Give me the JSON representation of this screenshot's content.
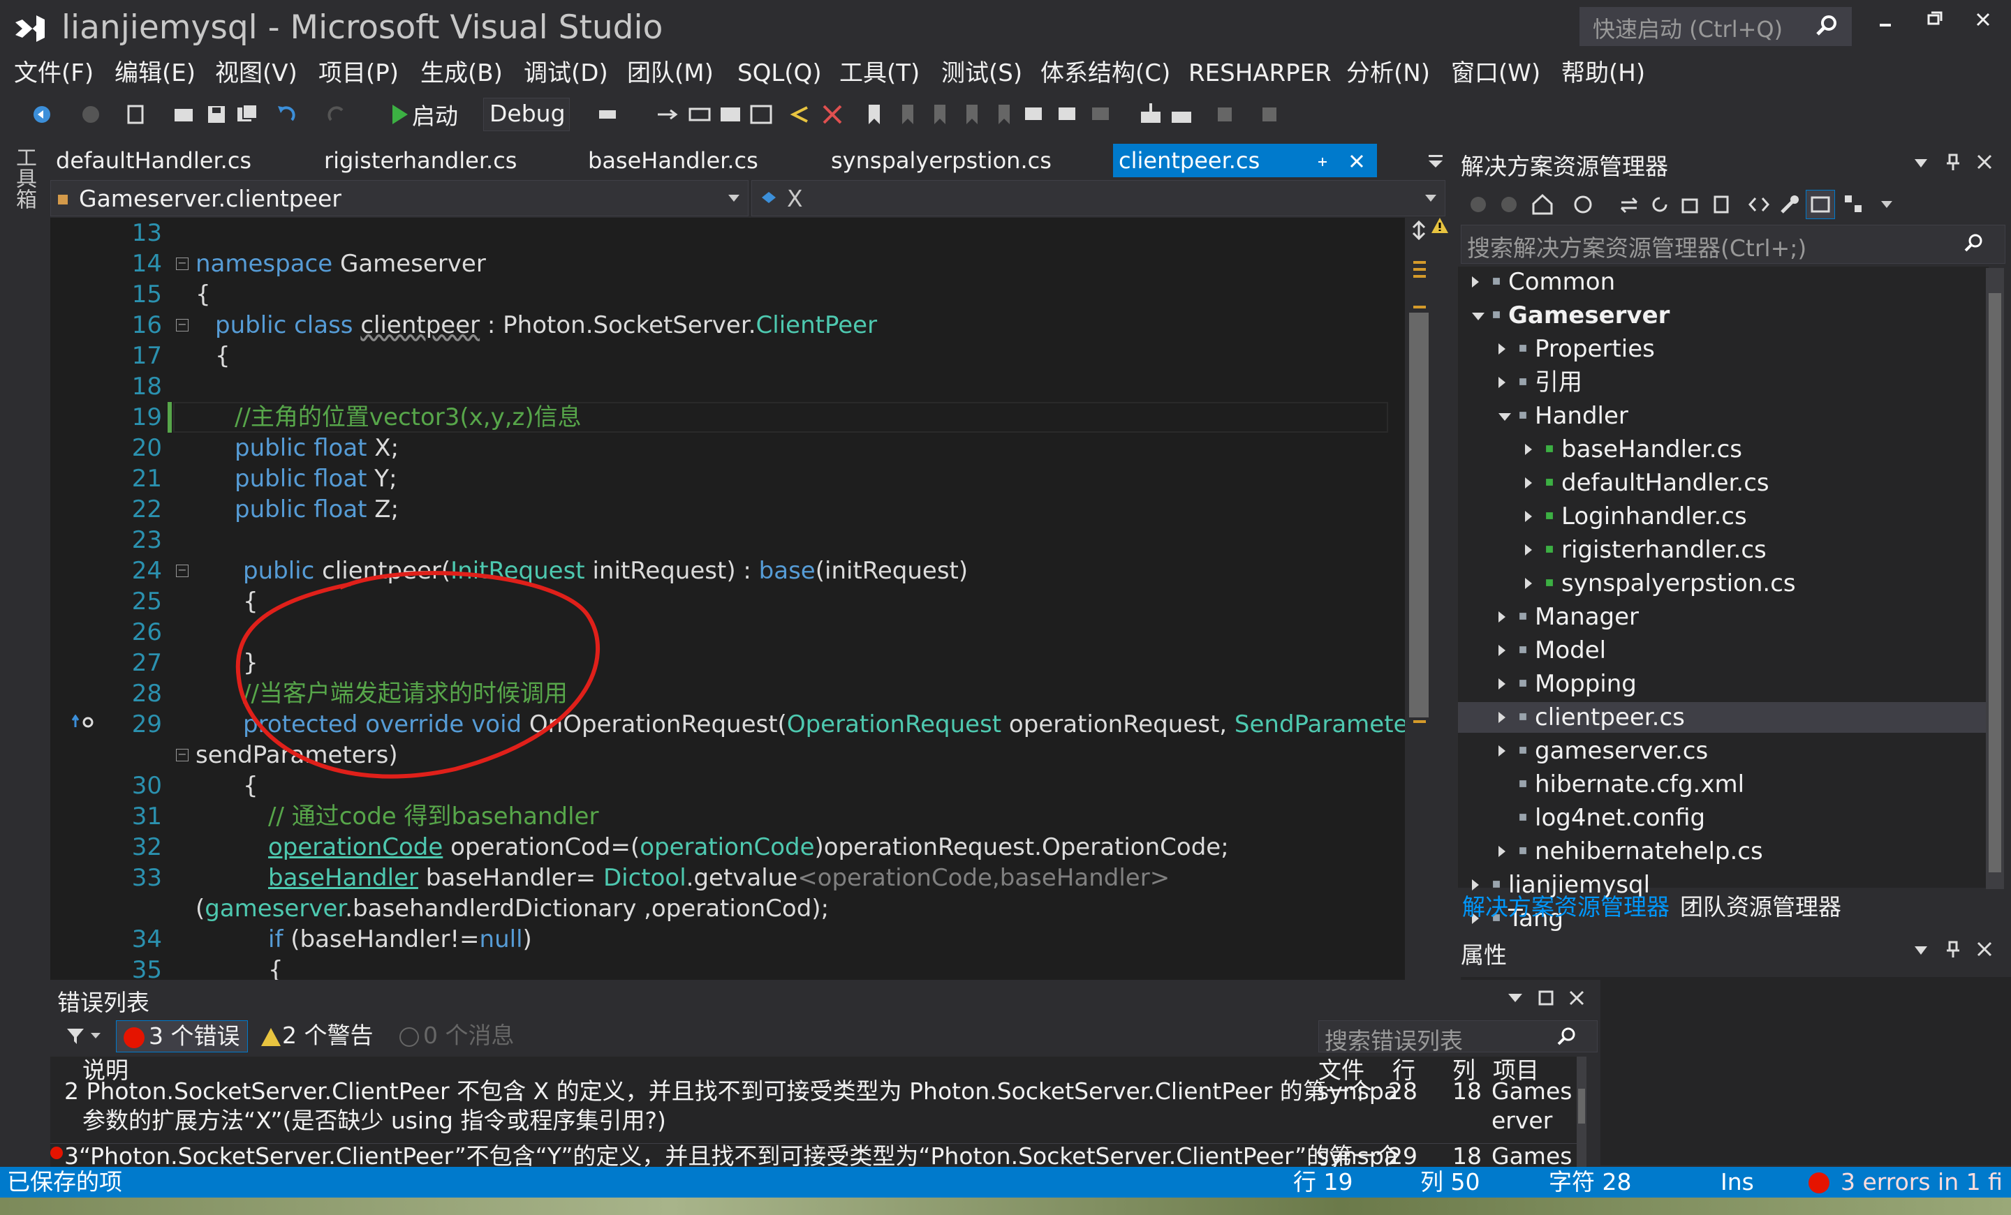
{
  "window": {
    "title": "lianjiemysql - Microsoft Visual Studio",
    "quick_launch_placeholder": "快速启动 (Ctrl+Q)"
  },
  "menu": [
    "文件(F)",
    "编辑(E)",
    "视图(V)",
    "项目(P)",
    "生成(B)",
    "调试(D)",
    "团队(M)",
    "SQL(Q)",
    "工具(T)",
    "测试(S)",
    "体系结构(C)",
    "RESHARPER",
    "分析(N)",
    "窗口(W)",
    "帮助(H)"
  ],
  "toolbar": {
    "start_label": "启动",
    "config_value": "Debug"
  },
  "toolbox_label": "工具箱",
  "tabs": [
    "defaultHandler.cs",
    "rigisterhandler.cs",
    "baseHandler.cs",
    "synspalyerpstion.cs",
    "clientpeer.cs"
  ],
  "nav": {
    "left": "Gameserver.clientpeer",
    "right": "X"
  },
  "code": {
    "line_numbers": [
      "13",
      "14",
      "15",
      "16",
      "17",
      "18",
      "19",
      "20",
      "21",
      "22",
      "23",
      "24",
      "25",
      "26",
      "27",
      "28",
      "29",
      "",
      "30",
      "31",
      "32",
      "33",
      "",
      "34",
      "35"
    ],
    "l14_kw": "namespace",
    "l14_name": " Gameserver",
    "brace_open": "{",
    "brace_close": "}",
    "l16_kw": "public class",
    "l16_name": "clientpeer",
    "l16_mid": " : Photon.SocketServer.",
    "l16_type": "ClientPeer",
    "l19_comment": "//主角的位置vector3(x,y,z)信息",
    "public_float": "public float",
    "x_field": " X;",
    "y_field": " Y;",
    "z_field": " Z;",
    "l24_kw": "public",
    "l24_name": " clientpeer(",
    "l24_type": "InitRequest",
    "l24_mid": " initRequest) : ",
    "l24_base": "base",
    "l24_end": "(initRequest)",
    "l28_comment": "//当客户端发起请求的时候调用",
    "l29_kw": "protected override void",
    "l29_name": " OnOperationRequest(",
    "l29_type1": "OperationRequest",
    "l29_mid": " operationRequest, ",
    "l29_type2": "SendParameters",
    "l29b": "sendParameters)",
    "l31_comment": "//  通过code 得到basehandler",
    "l32_type": "operationCode",
    "l32_a": " operationCod=(",
    "l32_type2": "operationCode",
    "l32_b": ")operationRequest.OperationCode;",
    "l33_type": "baseHandler",
    "l33_a": " baseHandler= ",
    "l33_type2": "Dictool",
    "l33_b": ".getvalue",
    "l33_gen": "<operationCode,baseHandler>",
    "l33b_a": "(",
    "l33b_type": "gameserver",
    "l33b_b": ".basehandlerdDictionary ,operationCod);",
    "l34_kw": "if",
    "l34_a": " (baseHandler!=",
    "l34_null": "null",
    "l34_b": ")"
  },
  "solution_explorer": {
    "title": "解决方案资源管理器",
    "search_placeholder": "搜索解决方案资源管理器(Ctrl+;)",
    "items": [
      {
        "label": "Common",
        "depth": 0,
        "arrow": "closed"
      },
      {
        "label": "Gameserver",
        "depth": 0,
        "arrow": "open"
      },
      {
        "label": "Properties",
        "depth": 1,
        "arrow": "closed"
      },
      {
        "label": "引用",
        "depth": 1,
        "arrow": "closed"
      },
      {
        "label": "Handler",
        "depth": 1,
        "arrow": "open"
      },
      {
        "label": "baseHandler.cs",
        "depth": 2,
        "arrow": "closed"
      },
      {
        "label": "defaultHandler.cs",
        "depth": 2,
        "arrow": "closed"
      },
      {
        "label": "Loginhandler.cs",
        "depth": 2,
        "arrow": "closed"
      },
      {
        "label": "rigisterhandler.cs",
        "depth": 2,
        "arrow": "closed"
      },
      {
        "label": "synspalyerpstion.cs",
        "depth": 2,
        "arrow": "closed"
      },
      {
        "label": "Manager",
        "depth": 1,
        "arrow": "closed"
      },
      {
        "label": "Model",
        "depth": 1,
        "arrow": "closed"
      },
      {
        "label": "Mopping",
        "depth": 1,
        "arrow": "closed"
      },
      {
        "label": "clientpeer.cs",
        "depth": 1,
        "arrow": "closed"
      },
      {
        "label": "gameserver.cs",
        "depth": 1,
        "arrow": "closed"
      },
      {
        "label": "hibernate.cfg.xml",
        "depth": 1,
        "arrow": "none"
      },
      {
        "label": "log4net.config",
        "depth": 1,
        "arrow": "none"
      },
      {
        "label": "nehibernatehelp.cs",
        "depth": 1,
        "arrow": "closed"
      },
      {
        "label": "lianjiemysql",
        "depth": 0,
        "arrow": "closed"
      },
      {
        "label": "Tang",
        "depth": 0,
        "arrow": "closed"
      }
    ],
    "tab_solution": "解决方案资源管理器",
    "tab_team": "团队资源管理器"
  },
  "properties_title": "属性",
  "error_list": {
    "title": "错误列表",
    "errors_btn": "3 个错误",
    "warnings_btn": "2 个警告",
    "messages_btn": "0 个消息",
    "search_placeholder": "搜索错误列表",
    "col_desc": "说明",
    "col_file": "文件",
    "col_line": "行",
    "col_col": "列",
    "col_project": "项目",
    "row2_desc": "2  Photon.SocketServer.ClientPeer 不包含 X 的定义，并且找不到可接受类型为 Photon.SocketServer.ClientPeer 的第一个",
    "row2_desc2": "参数的扩展方法“X”(是否缺少 using 指令或程序集引用?)",
    "row2_file": "synspa",
    "row2_line": "28",
    "row2_col": "18",
    "row2_project": "Games",
    "row2_project2": "erver",
    "row3_desc": "3“Photon.SocketServer.ClientPeer”不包含“Y”的定义，并且找不到可接受类型为“Photon.SocketServer.ClientPeer”的第一个",
    "row3_file": "synspa",
    "row3_line": "29",
    "row3_col": "18",
    "row3_project": "Games"
  },
  "status": {
    "saved": "已保存的项",
    "row": "行 19",
    "col": "列 50",
    "char": "字符 28",
    "ins": "Ins",
    "errors": "3 errors in 1 fi"
  },
  "colors": {
    "accent": "#007acc",
    "annotation": "#e0201a",
    "keyword": "#569cd6",
    "type": "#4ec9b0",
    "comment": "#57a64a"
  }
}
